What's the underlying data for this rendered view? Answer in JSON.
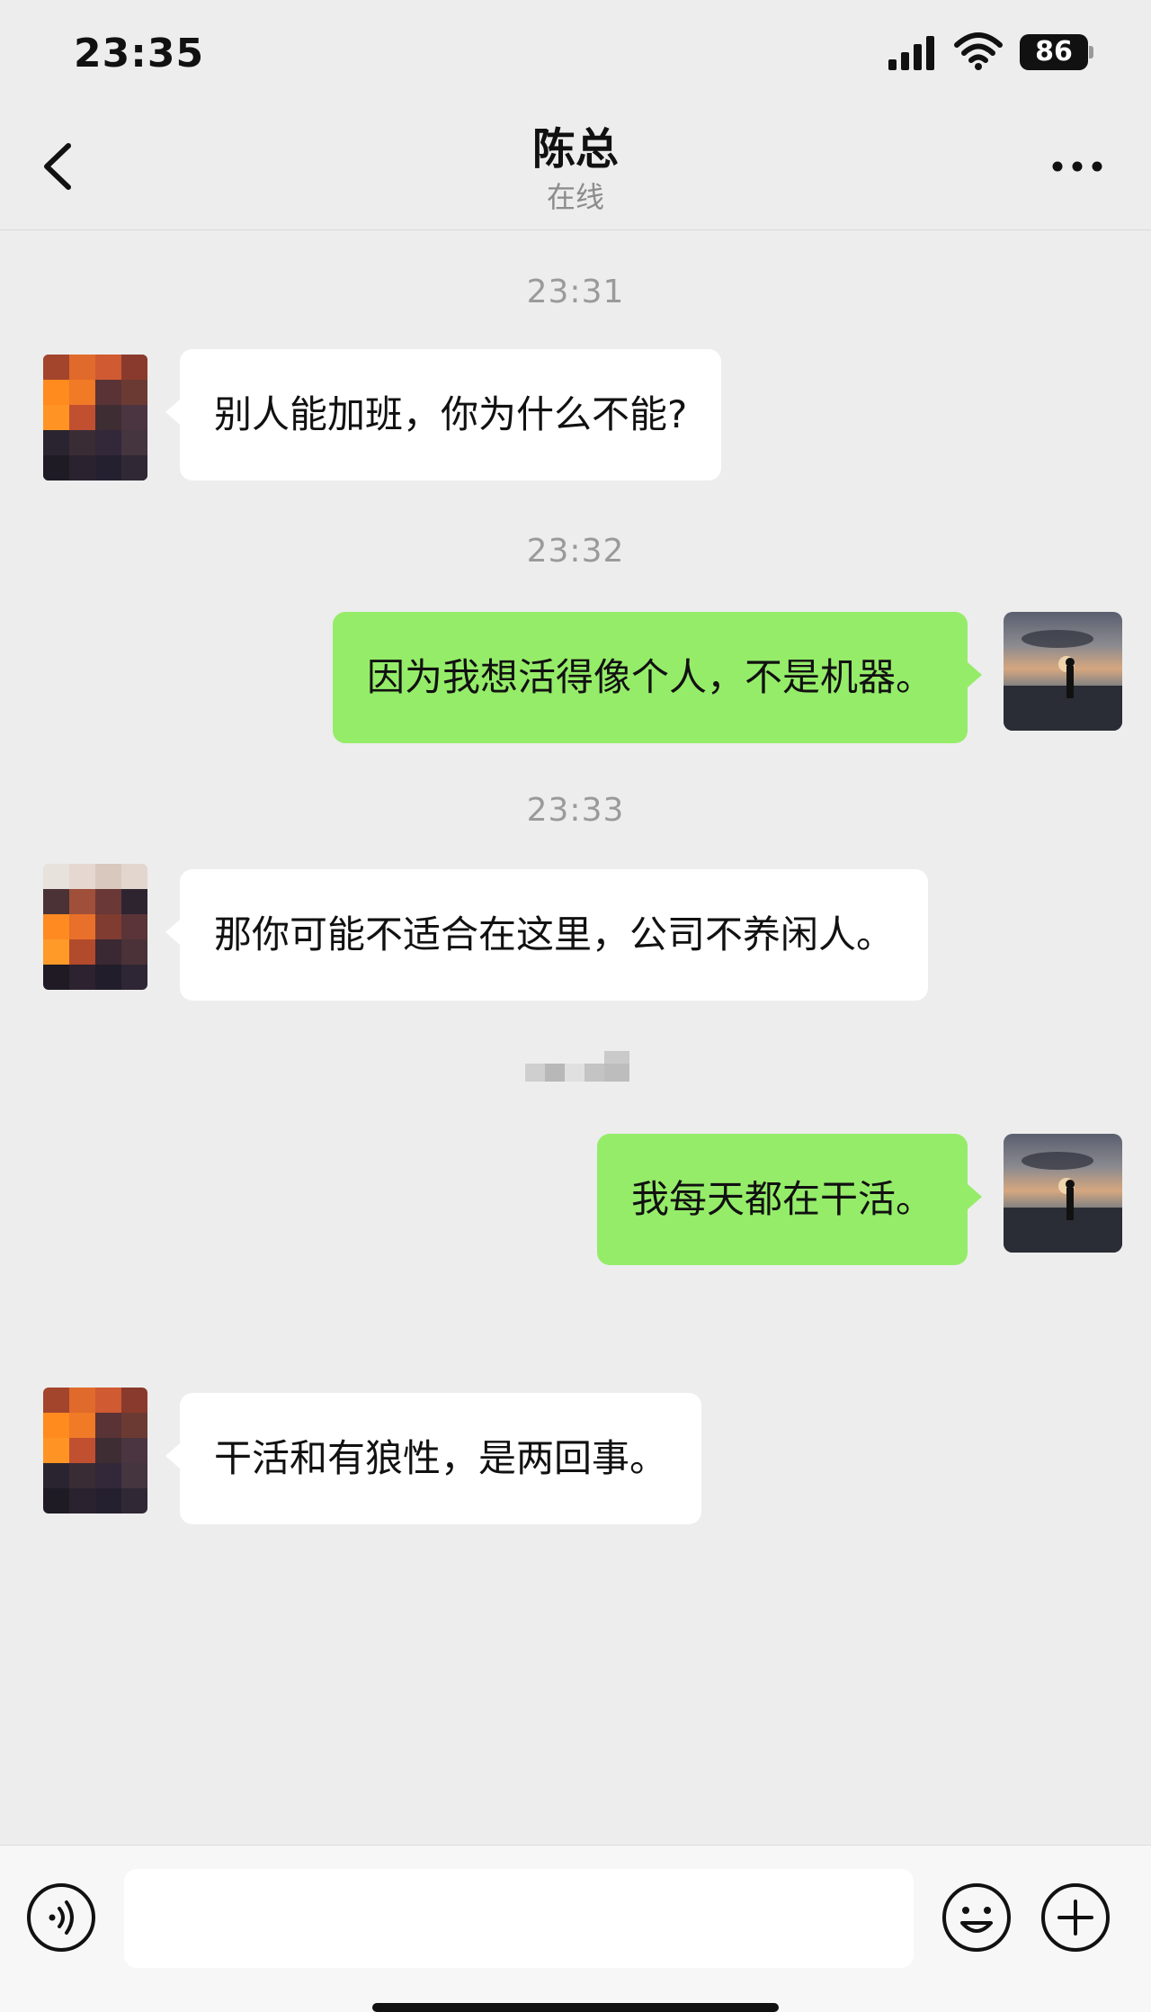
{
  "status_bar": {
    "time": "23:35",
    "battery": "86",
    "icons": [
      "signal-icon",
      "wifi-icon",
      "battery-icon"
    ]
  },
  "header": {
    "title": "陈总",
    "subtitle": "在线",
    "icons": [
      "chevron-left-icon",
      "more-icon"
    ]
  },
  "messages": [
    {
      "time": "23:31",
      "sender": "other",
      "text": "别人能加班，你为什么不能?"
    },
    {
      "time": "23:32",
      "sender": "self",
      "text": "因为我想活得像个人，不是机器。"
    },
    {
      "time": "23:33",
      "sender": "other",
      "text": "那你可能不适合在这里，公司不养闲人。"
    },
    {
      "time": "",
      "sender": "self",
      "text": "我每天都在干活。"
    },
    {
      "time": "",
      "sender": "other",
      "text": "干活和有狼性，是两回事。"
    }
  ],
  "input_bar": {
    "placeholder": "",
    "icons": [
      "voice-icon",
      "emoji-icon",
      "plus-icon"
    ]
  },
  "colors": {
    "background": "#ededed",
    "incoming_bubble": "#ffffff",
    "outgoing_bubble": "#95ec69",
    "timestamp": "#9a9a9a"
  }
}
